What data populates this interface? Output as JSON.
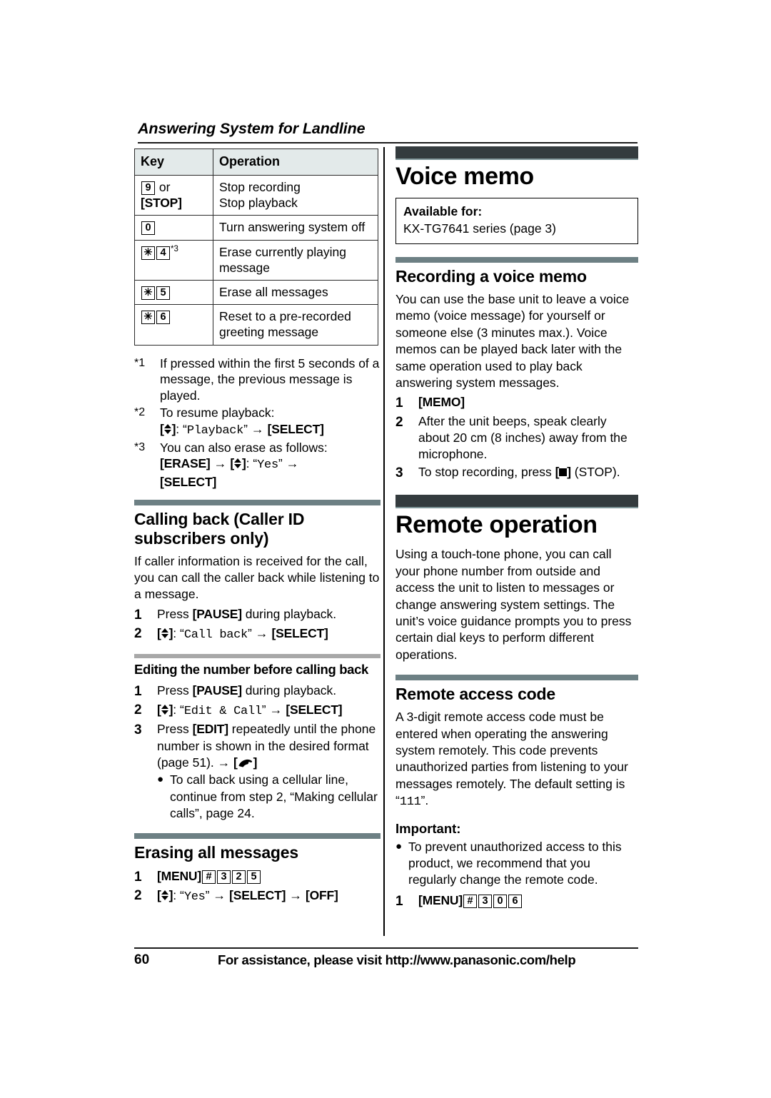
{
  "running_header": "Answering System for Landline",
  "key_table": {
    "headers": [
      "Key",
      "Operation"
    ],
    "rows": [
      {
        "key_glyphs": [
          "9"
        ],
        "key_suffix": "or",
        "key_bracket": "[STOP]",
        "operation": "Stop recording\nStop playback"
      },
      {
        "key_glyphs": [
          "0"
        ],
        "operation": "Turn answering system off"
      },
      {
        "key_glyphs": [
          "✳",
          "4"
        ],
        "key_note": "*3",
        "operation": "Erase currently playing message"
      },
      {
        "key_glyphs": [
          "✳",
          "5"
        ],
        "operation": "Erase all messages"
      },
      {
        "key_glyphs": [
          "✳",
          "6"
        ],
        "operation": "Reset to a pre-recorded greeting message"
      }
    ]
  },
  "footnotes": [
    {
      "mark": "*1",
      "text": "If pressed within the first 5 seconds of a message, the previous message is played."
    },
    {
      "mark": "*2",
      "text": "To resume playback:",
      "command_display": "Playback",
      "command_tail": "[SELECT]"
    },
    {
      "mark": "*3",
      "text": "You can also erase as follows:",
      "command_lead": "[ERASE]",
      "command_display": "Yes",
      "command_tail": "[SELECT]"
    }
  ],
  "calling_back": {
    "title": "Calling back (Caller ID subscribers only)",
    "intro": "If caller information is received for the call, you can call the caller back while listening to a message.",
    "steps": [
      {
        "num": "1",
        "text_pre": "Press ",
        "key": "[PAUSE]",
        "text_post": " during playback."
      },
      {
        "num": "2",
        "display": "Call back",
        "tail": "[SELECT]"
      }
    ]
  },
  "editing_number": {
    "title": "Editing the number before calling back",
    "steps": [
      {
        "num": "1",
        "text_pre": "Press ",
        "key": "[PAUSE]",
        "text_post": " during playback."
      },
      {
        "num": "2",
        "display": "Edit & Call",
        "tail": "[SELECT]"
      },
      {
        "num": "3",
        "text_pre": "Press ",
        "key": "[EDIT]",
        "text_post": " repeatedly until the phone number is shown in the desired format (page 51). → "
      }
    ],
    "bullet": "To call back using a cellular line, continue from step 2, “Making cellular calls”, page 24."
  },
  "erasing_all": {
    "title": "Erasing all messages",
    "steps": [
      {
        "num": "1",
        "key": "[MENU]",
        "glyphs": [
          "#",
          "3",
          "2",
          "5"
        ]
      },
      {
        "num": "2",
        "display": "Yes",
        "tail1": "[SELECT]",
        "tail2": "[OFF]"
      }
    ]
  },
  "voice_memo": {
    "title": "Voice memo",
    "available_label": "Available for:",
    "available_value": "KX-TG7641 series (page 3)",
    "recording": {
      "title": "Recording a voice memo",
      "intro": "You can use the base unit to leave a voice memo (voice message) for yourself or someone else (3 minutes max.). Voice memos can be played back later with the same operation used to play back answering system messages.",
      "steps": [
        {
          "num": "1",
          "key": "[MEMO]"
        },
        {
          "num": "2",
          "text": "After the unit beeps, speak clearly about 20 cm (8 inches) away from the microphone."
        },
        {
          "num": "3",
          "text_pre": "To stop recording, press ",
          "text_post": " (STOP)."
        }
      ]
    }
  },
  "remote_operation": {
    "title": "Remote operation",
    "intro": "Using a touch-tone phone, you can call your phone number from outside and access the unit to listen to messages or change answering system settings. The unit’s voice guidance prompts you to press certain dial keys to perform different operations.",
    "access_code": {
      "title": "Remote access code",
      "intro_pre": "A 3-digit remote access code must be entered when operating the answering system remotely. This code prevents unauthorized parties from listening to your messages remotely. The default setting is “",
      "default_code": "111",
      "intro_post": "”.",
      "important_label": "Important:",
      "important_bullet": "To prevent unauthorized access to this product, we recommend that you regularly change the remote code.",
      "steps": [
        {
          "num": "1",
          "key": "[MENU]",
          "glyphs": [
            "#",
            "3",
            "0",
            "6"
          ]
        }
      ]
    }
  },
  "footer": {
    "page_number": "60",
    "text": "For assistance, please visit http://www.panasonic.com/help"
  },
  "colors": {
    "bar_major": "#343b3e",
    "bar_major_underline": "#7d9396",
    "bar_minor": "#6d8084",
    "bar_sub": "#a8a8a8",
    "table_header_bg": "#e3eaea"
  }
}
